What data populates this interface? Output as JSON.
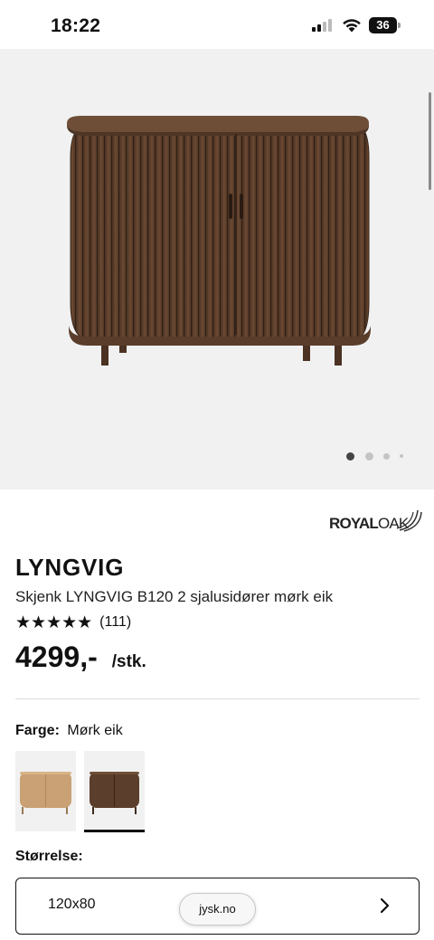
{
  "status_bar": {
    "time": "18:22",
    "battery": "36"
  },
  "product": {
    "brand": {
      "bold": "ROYAL",
      "light": "OAK"
    },
    "name": "LYNGVIG",
    "description": "Skjenk LYNGVIG B120 2 sjalusidører mørk eik",
    "stars": "★★★★★",
    "rating_count": "(111)",
    "price": "4299,-",
    "unit": "/stk."
  },
  "gallery": {
    "image_count": 4,
    "active_index": 0
  },
  "color": {
    "label": "Farge:",
    "value": "Mørk eik",
    "options": [
      {
        "name": "light oak",
        "color": "#c49a6c",
        "selected": false
      },
      {
        "name": "dark oak",
        "color": "#5a3d2b",
        "selected": true
      }
    ]
  },
  "size": {
    "label": "Størrelse:",
    "value": "120x80"
  },
  "browser": {
    "url": "jysk.no"
  },
  "colors": {
    "wood_dark": "#5b3e2b",
    "wood_light": "#c9a174",
    "background": "#f1f1f1"
  }
}
